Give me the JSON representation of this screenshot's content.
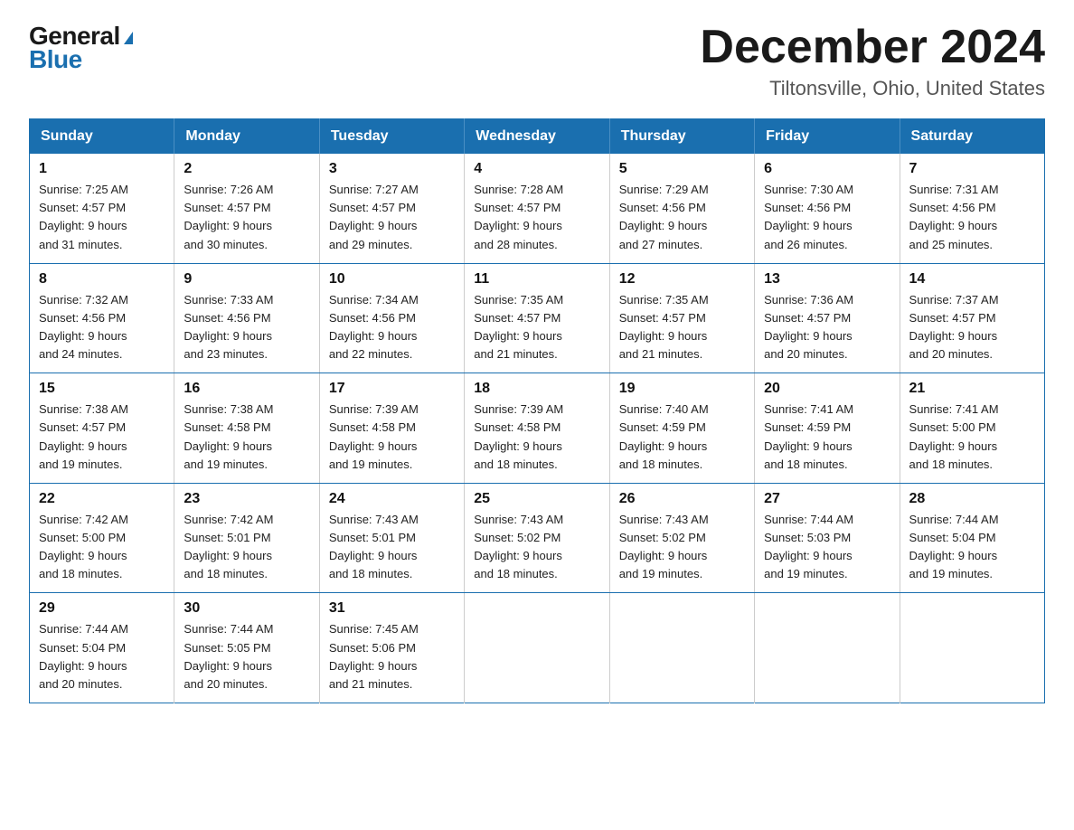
{
  "logo": {
    "general": "General",
    "blue": "Blue",
    "triangle": "▶"
  },
  "title": "December 2024",
  "location": "Tiltonsville, Ohio, United States",
  "days_of_week": [
    "Sunday",
    "Monday",
    "Tuesday",
    "Wednesday",
    "Thursday",
    "Friday",
    "Saturday"
  ],
  "weeks": [
    [
      {
        "day": "1",
        "sunrise": "7:25 AM",
        "sunset": "4:57 PM",
        "daylight": "9 hours and 31 minutes."
      },
      {
        "day": "2",
        "sunrise": "7:26 AM",
        "sunset": "4:57 PM",
        "daylight": "9 hours and 30 minutes."
      },
      {
        "day": "3",
        "sunrise": "7:27 AM",
        "sunset": "4:57 PM",
        "daylight": "9 hours and 29 minutes."
      },
      {
        "day": "4",
        "sunrise": "7:28 AM",
        "sunset": "4:57 PM",
        "daylight": "9 hours and 28 minutes."
      },
      {
        "day": "5",
        "sunrise": "7:29 AM",
        "sunset": "4:56 PM",
        "daylight": "9 hours and 27 minutes."
      },
      {
        "day": "6",
        "sunrise": "7:30 AM",
        "sunset": "4:56 PM",
        "daylight": "9 hours and 26 minutes."
      },
      {
        "day": "7",
        "sunrise": "7:31 AM",
        "sunset": "4:56 PM",
        "daylight": "9 hours and 25 minutes."
      }
    ],
    [
      {
        "day": "8",
        "sunrise": "7:32 AM",
        "sunset": "4:56 PM",
        "daylight": "9 hours and 24 minutes."
      },
      {
        "day": "9",
        "sunrise": "7:33 AM",
        "sunset": "4:56 PM",
        "daylight": "9 hours and 23 minutes."
      },
      {
        "day": "10",
        "sunrise": "7:34 AM",
        "sunset": "4:56 PM",
        "daylight": "9 hours and 22 minutes."
      },
      {
        "day": "11",
        "sunrise": "7:35 AM",
        "sunset": "4:57 PM",
        "daylight": "9 hours and 21 minutes."
      },
      {
        "day": "12",
        "sunrise": "7:35 AM",
        "sunset": "4:57 PM",
        "daylight": "9 hours and 21 minutes."
      },
      {
        "day": "13",
        "sunrise": "7:36 AM",
        "sunset": "4:57 PM",
        "daylight": "9 hours and 20 minutes."
      },
      {
        "day": "14",
        "sunrise": "7:37 AM",
        "sunset": "4:57 PM",
        "daylight": "9 hours and 20 minutes."
      }
    ],
    [
      {
        "day": "15",
        "sunrise": "7:38 AM",
        "sunset": "4:57 PM",
        "daylight": "9 hours and 19 minutes."
      },
      {
        "day": "16",
        "sunrise": "7:38 AM",
        "sunset": "4:58 PM",
        "daylight": "9 hours and 19 minutes."
      },
      {
        "day": "17",
        "sunrise": "7:39 AM",
        "sunset": "4:58 PM",
        "daylight": "9 hours and 19 minutes."
      },
      {
        "day": "18",
        "sunrise": "7:39 AM",
        "sunset": "4:58 PM",
        "daylight": "9 hours and 18 minutes."
      },
      {
        "day": "19",
        "sunrise": "7:40 AM",
        "sunset": "4:59 PM",
        "daylight": "9 hours and 18 minutes."
      },
      {
        "day": "20",
        "sunrise": "7:41 AM",
        "sunset": "4:59 PM",
        "daylight": "9 hours and 18 minutes."
      },
      {
        "day": "21",
        "sunrise": "7:41 AM",
        "sunset": "5:00 PM",
        "daylight": "9 hours and 18 minutes."
      }
    ],
    [
      {
        "day": "22",
        "sunrise": "7:42 AM",
        "sunset": "5:00 PM",
        "daylight": "9 hours and 18 minutes."
      },
      {
        "day": "23",
        "sunrise": "7:42 AM",
        "sunset": "5:01 PM",
        "daylight": "9 hours and 18 minutes."
      },
      {
        "day": "24",
        "sunrise": "7:43 AM",
        "sunset": "5:01 PM",
        "daylight": "9 hours and 18 minutes."
      },
      {
        "day": "25",
        "sunrise": "7:43 AM",
        "sunset": "5:02 PM",
        "daylight": "9 hours and 18 minutes."
      },
      {
        "day": "26",
        "sunrise": "7:43 AM",
        "sunset": "5:02 PM",
        "daylight": "9 hours and 19 minutes."
      },
      {
        "day": "27",
        "sunrise": "7:44 AM",
        "sunset": "5:03 PM",
        "daylight": "9 hours and 19 minutes."
      },
      {
        "day": "28",
        "sunrise": "7:44 AM",
        "sunset": "5:04 PM",
        "daylight": "9 hours and 19 minutes."
      }
    ],
    [
      {
        "day": "29",
        "sunrise": "7:44 AM",
        "sunset": "5:04 PM",
        "daylight": "9 hours and 20 minutes."
      },
      {
        "day": "30",
        "sunrise": "7:44 AM",
        "sunset": "5:05 PM",
        "daylight": "9 hours and 20 minutes."
      },
      {
        "day": "31",
        "sunrise": "7:45 AM",
        "sunset": "5:06 PM",
        "daylight": "9 hours and 21 minutes."
      },
      null,
      null,
      null,
      null
    ]
  ],
  "labels": {
    "sunrise": "Sunrise:",
    "sunset": "Sunset:",
    "daylight": "Daylight:"
  }
}
